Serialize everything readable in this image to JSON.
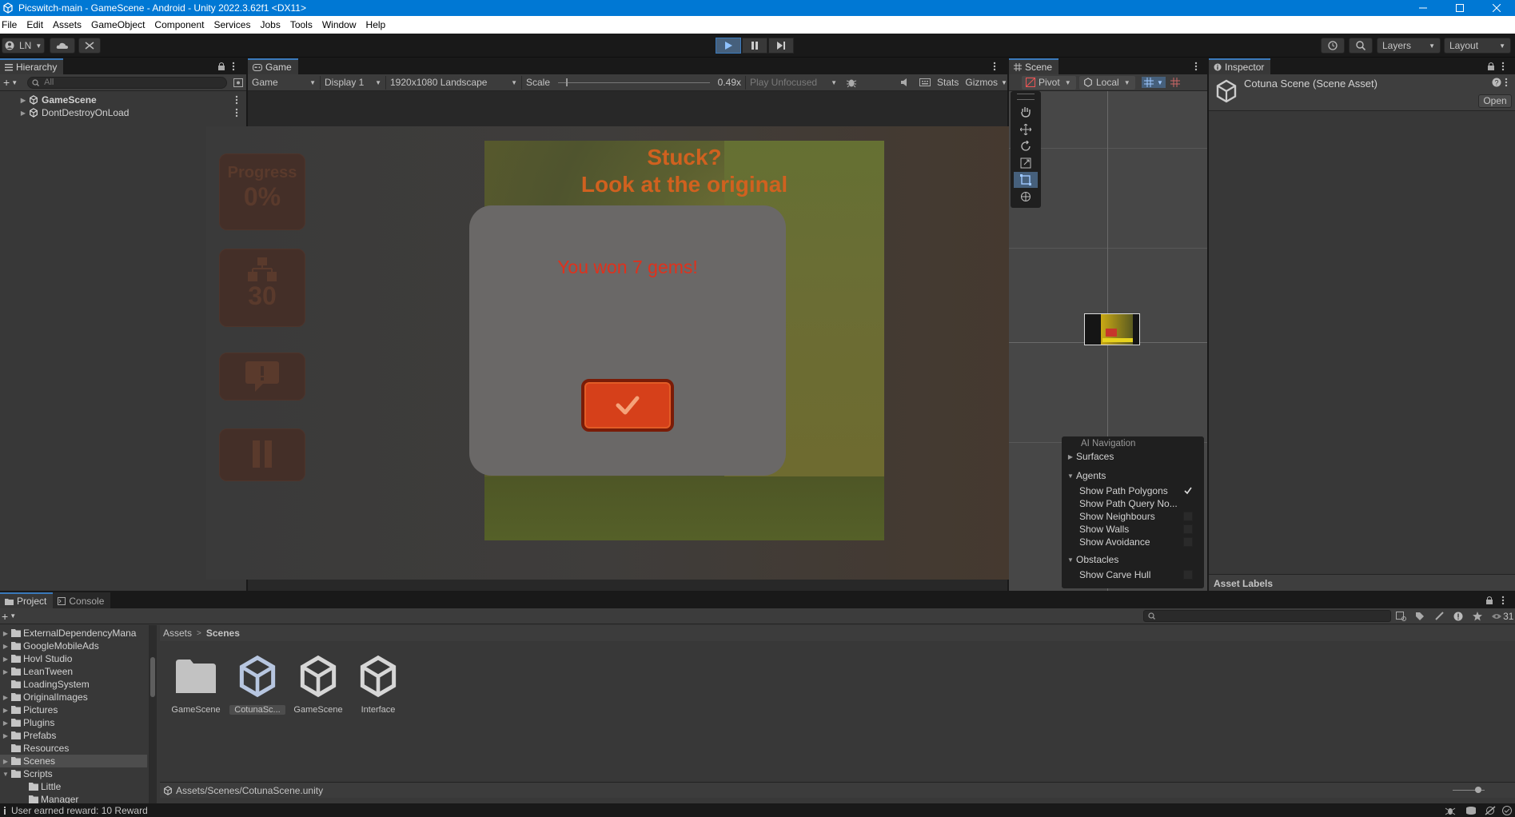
{
  "window": {
    "title": "Picswitch-main - GameScene - Android - Unity 2022.3.62f1 <DX11>"
  },
  "menu": [
    "File",
    "Edit",
    "Assets",
    "GameObject",
    "Component",
    "Services",
    "Jobs",
    "Tools",
    "Window",
    "Help"
  ],
  "toolbar": {
    "account_label": "LN",
    "layers_label": "Layers",
    "layout_label": "Layout"
  },
  "hierarchy": {
    "tab": "Hierarchy",
    "search_placeholder": "All",
    "items": [
      {
        "label": "GameScene"
      },
      {
        "label": "DontDestroyOnLoad"
      }
    ]
  },
  "game": {
    "tab": "Game",
    "view_mode": "Game",
    "display": "Display 1",
    "resolution": "1920x1080 Landscape",
    "scale_label": "Scale",
    "scale_value": "0.49x",
    "play_mode": "Play Unfocused",
    "stats_label": "Stats",
    "gizmos_label": "Gizmos",
    "scale_fraction": 0.05,
    "screen": {
      "progress_label": "Progress",
      "progress_value": "0%",
      "moves_value": "30",
      "stuck_line1": "Stuck?",
      "stuck_line2": "Look at the original",
      "reward_text": "You won 7 gems!"
    }
  },
  "scene": {
    "tab": "Scene",
    "pivot_label": "Pivot",
    "local_label": "Local",
    "ai_nav": {
      "title": "AI Navigation",
      "surfaces": "Surfaces",
      "agents": "Agents",
      "agent_options": [
        {
          "label": "Show Path Polygons",
          "checked": true
        },
        {
          "label": "Show Path Query No...",
          "checked": false
        },
        {
          "label": "Show Neighbours",
          "checked": false
        },
        {
          "label": "Show Walls",
          "checked": false
        },
        {
          "label": "Show Avoidance",
          "checked": false
        }
      ],
      "obstacles": "Obstacles",
      "obstacle_options": [
        {
          "label": "Show Carve Hull",
          "checked": false
        }
      ]
    }
  },
  "inspector": {
    "tab": "Inspector",
    "asset_title": "Cotuna Scene (Scene Asset)",
    "open_button": "Open",
    "asset_labels": "Asset Labels"
  },
  "project": {
    "tab": "Project",
    "console_tab": "Console",
    "folders": [
      {
        "label": "ExternalDependencyMana"
      },
      {
        "label": "GoogleMobileAds"
      },
      {
        "label": "Hovl Studio"
      },
      {
        "label": "LeanTween"
      },
      {
        "label": "LoadingSystem"
      },
      {
        "label": "OriginalImages"
      },
      {
        "label": "Pictures"
      },
      {
        "label": "Plugins"
      },
      {
        "label": "Prefabs"
      },
      {
        "label": "Resources"
      },
      {
        "label": "Scenes"
      },
      {
        "label": "Scripts"
      },
      {
        "label": "Little"
      },
      {
        "label": "Manager"
      }
    ],
    "breadcrumb_root": "Assets",
    "breadcrumb_current": "Scenes",
    "assets": [
      {
        "label": "GameScene",
        "kind": "folder"
      },
      {
        "label": "CotunaSc...",
        "kind": "unity-scene"
      },
      {
        "label": "GameScene",
        "kind": "unity-scene"
      },
      {
        "label": "Interface",
        "kind": "unity-scene"
      }
    ],
    "path": "Assets/Scenes/CotunaScene.unity",
    "visible_count": "31"
  },
  "status": {
    "message": "User earned reward: 10 Reward"
  },
  "colors": {
    "accent": "#0078d4",
    "panel": "#383838",
    "dialog_text": "#e0311c",
    "orange_text": "#d0611f"
  }
}
